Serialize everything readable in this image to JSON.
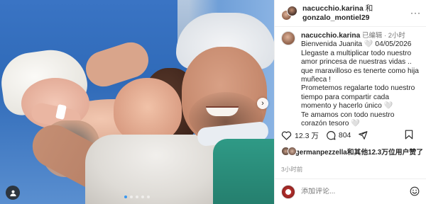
{
  "header": {
    "user1": "nacucchio.karina",
    "and_label": "和",
    "user2": "gonzalo_montiel29",
    "more": "···"
  },
  "caption": {
    "username": "nacucchio.karina",
    "edited": "已编辑",
    "time": "2小时",
    "lines": [
      "Bienvenida Juanita 🤍 04/05/2026",
      "Llegaste a multiplicar todo nuestro",
      "amor princesa de nuestras vidas ..",
      "que maravilloso es tenerte como hija",
      "muñeca !",
      "Prometemos regalarte todo nuestro",
      "tiempo para compartir cada",
      "momento y hacerlo único 🤍",
      "Te amamos con todo nuestro",
      "corazón tesoro 🤍"
    ]
  },
  "actions": {
    "like_count": "12.3 万",
    "comment_count": "804"
  },
  "likes": {
    "text": "germanpezzella和其他12.3万位用户赞了"
  },
  "time_ago": "3小时前",
  "comment": {
    "placeholder": "添加评论..."
  },
  "media": {
    "next_glyph": "›",
    "dots": 5,
    "active_dot": 0
  },
  "colors": {
    "accent": "#3897f0",
    "text": "#262626",
    "muted": "#737373",
    "scrubs": "#2f9a86"
  }
}
